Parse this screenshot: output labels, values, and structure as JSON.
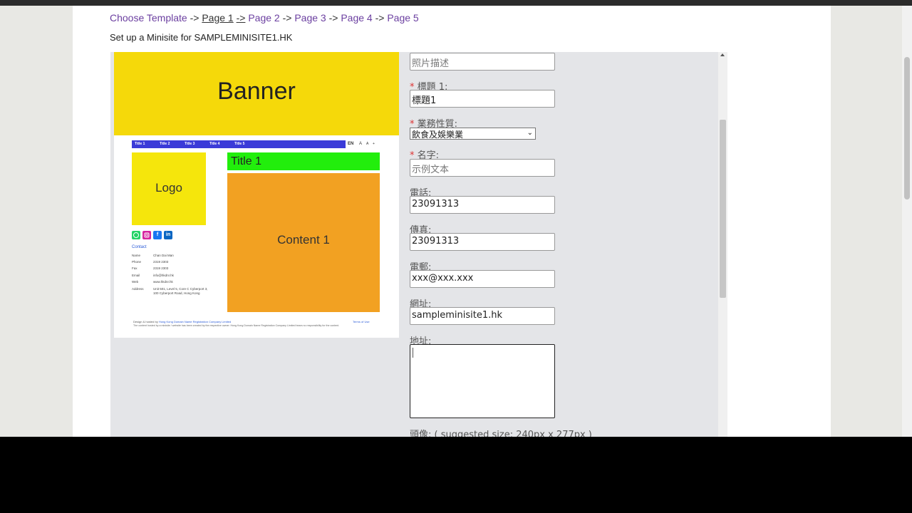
{
  "breadcrumb": {
    "choose_template": "Choose Template",
    "sep": "->",
    "page1": "Page 1",
    "page2": "Page 2",
    "page3": "Page 3",
    "page4": "Page 4",
    "page5": "Page 5"
  },
  "subtitle": "Set up a Minisite for SAMPLEMINISITE1.HK",
  "preview": {
    "banner": "Banner",
    "nav": [
      "Title 1",
      "Title 2",
      "Title 3",
      "Title 4",
      "Title 5"
    ],
    "lang": "EN",
    "font_small": "A",
    "font_mid": "A",
    "font_big": "+",
    "logo": "Logo",
    "title1": "Title 1",
    "content1": "Content 1",
    "contact_label": "Contact",
    "contact": [
      {
        "k": "Name",
        "v": "Chan Dai Man"
      },
      {
        "k": "Phone",
        "v": "2319 2303"
      },
      {
        "k": "Fax",
        "v": "2319 2303"
      },
      {
        "k": "Email",
        "v": "info@hkdnr.hk"
      },
      {
        "k": "Web",
        "v": "www.hkdnr.hk"
      },
      {
        "k": "Address",
        "v": "Unit 501, Level 5, Core C Cyberport 3, 100 Cyberport Road, Hong Kong"
      }
    ],
    "footer_prefix": "Design & hosted by",
    "footer_company": "Hong Kong Domain Name Registration Company Limited",
    "footer_terms": "Terms of Use",
    "footer_text": "The content hosted by a minisite / website has been created by the respective owner. Hong Kong Domain Name Registration Company Limited bears no responsibility for the content."
  },
  "form": {
    "photo_desc_placeholder": "照片描述",
    "title1_label": "標題 1:",
    "title1_value": "標題1",
    "business_label": "業務性質:",
    "business_value": "飲食及娛樂業",
    "name_label": "名字:",
    "name_placeholder": "示例文本",
    "phone_label": "電話:",
    "phone_value": "23091313",
    "fax_label": "傳真:",
    "fax_value": "23091313",
    "email_label": "電郵:",
    "email_value": "xxx@xxx.xxx",
    "website_label": "網址:",
    "website_value": "sampleminisite1.hk",
    "address_label": "地址:",
    "avatar_label": "頭像: ( suggested size: 240px x 277px )",
    "required_mark": "*"
  },
  "colors": {
    "banner": "#f5d90a",
    "nav": "#3b3bd8",
    "logo": "#f5e60c",
    "title_bar": "#22ee0c",
    "content": "#f2a122",
    "link": "#6b3fa0"
  }
}
